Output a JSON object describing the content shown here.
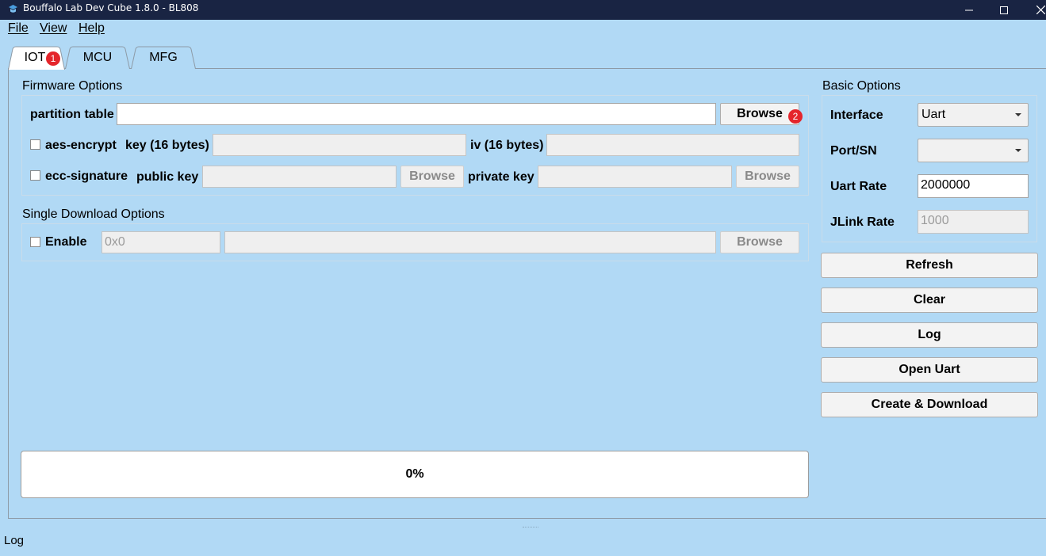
{
  "window": {
    "title": "Bouffalo Lab Dev Cube 1.8.0 - BL808",
    "controls": [
      "minimize-icon",
      "maximize-icon",
      "close-icon"
    ]
  },
  "menu": [
    "File",
    "View",
    "Help"
  ],
  "tabs": [
    {
      "label": "IOT",
      "active": true,
      "badge": "1"
    },
    {
      "label": "MCU",
      "active": false
    },
    {
      "label": "MFG",
      "active": false
    }
  ],
  "firmware": {
    "title": "Firmware Options",
    "partition_label": "partition table",
    "partition_value": "",
    "browse": "Browse",
    "browse_badge": "2",
    "aes_label": "aes-encrypt",
    "key_label": "key (16 bytes)",
    "key_value": "",
    "iv_label": "iv (16 bytes)",
    "iv_value": "",
    "ecc_label": "ecc-signature",
    "public_key_label": "public key",
    "public_key_value": "",
    "private_key_label": "private key",
    "private_key_value": ""
  },
  "single": {
    "title": "Single Download Options",
    "enable_label": "Enable",
    "address_placeholder": "0x0",
    "file_value": "",
    "browse": "Browse"
  },
  "basic": {
    "title": "Basic Options",
    "interface_label": "Interface",
    "interface_value": "Uart",
    "port_label": "Port/SN",
    "port_value": "",
    "uart_rate_label": "Uart Rate",
    "uart_rate_value": "2000000",
    "jlink_rate_label": "JLink Rate",
    "jlink_rate_value": "1000"
  },
  "actions": [
    "Refresh",
    "Clear",
    "Log",
    "Open Uart",
    "Create & Download"
  ],
  "progress": {
    "text": "0%",
    "percent": 0
  },
  "log_label": "Log",
  "colors": {
    "titlebar": "#192443",
    "background": "#b1d9f5",
    "badge": "#e4252b"
  }
}
